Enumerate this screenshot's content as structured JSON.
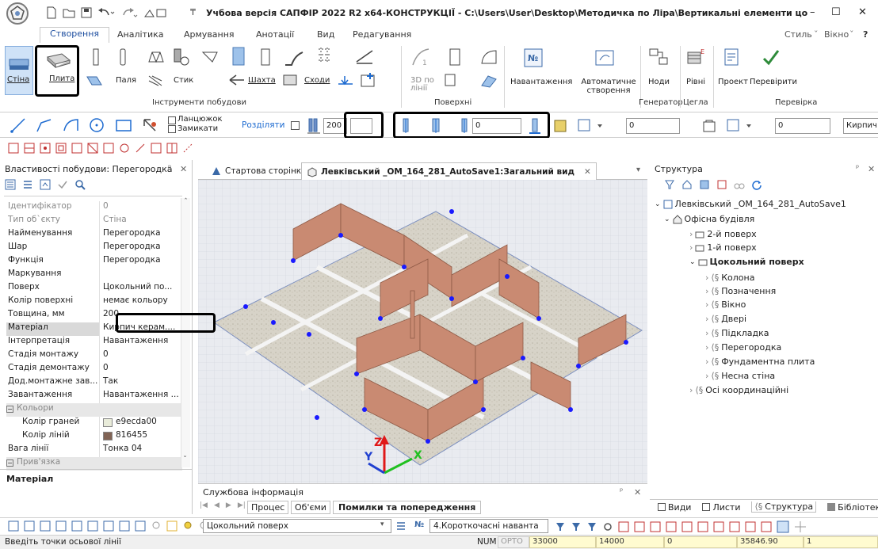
{
  "window": {
    "title": "Учбова версія САПФІР 2022 R2 x64-КОНСТРУКЦІЇ - C:\\Users\\User\\Desktop\\Методичка по Ліра\\Вертикальні елементи цоколя\\Левківськ...",
    "minimize": "–",
    "maximize": "☐",
    "close": "✕"
  },
  "menu": {
    "tabs": [
      "Створення",
      "Аналітика",
      "Армування",
      "Анотації",
      "Вид",
      "Редагування"
    ],
    "right": [
      "Стиль",
      "Вікно",
      "?"
    ]
  },
  "ribbon": {
    "buttons": {
      "wall": "Стіна",
      "slab": "Плита",
      "pile": "Паля",
      "column": "Стик",
      "shaft": "Шахта",
      "stairs": "Сходи",
      "surface3d": "3D по лінії",
      "loads": "Навантаження",
      "auto_create": "Автоматичне створення",
      "nodes": "Ноди",
      "levels": "Рівні",
      "project": "Проект",
      "verify": "Перевірити"
    },
    "groups": {
      "build_tools": "Інструменти побудови",
      "surfaces": "Поверхні",
      "generator": "Генератор",
      "bricks": "Цегла",
      "check": "Перевірка"
    }
  },
  "toolbar": {
    "chain_label": "Ланцюжок",
    "close_label": "Замикати",
    "split_label": "Розділяти",
    "thickness": "200",
    "height_value": "",
    "offset1": "0",
    "offset2": "0",
    "offset3": "0",
    "material_short": "Кирпич"
  },
  "left_panel": {
    "title": "Властивості побудови: Перегородка",
    "pin": "ᵖ",
    "close": "✕",
    "rows": [
      {
        "k": "Ідентифікатор",
        "v": "0",
        "muted": true
      },
      {
        "k": "Тип об`єкту",
        "v": "Стіна",
        "muted": true
      },
      {
        "k": "Найменування",
        "v": "Перегородка"
      },
      {
        "k": "Шар",
        "v": "Перегородка"
      },
      {
        "k": "Функція",
        "v": "Перегородка"
      },
      {
        "k": "Маркування",
        "v": ""
      },
      {
        "k": "Поверх",
        "v": "Цокольний по..."
      },
      {
        "k": "Колір поверхні",
        "v": "немає кольору"
      },
      {
        "k": "Товщина, мм",
        "v": "200"
      },
      {
        "k": "Матеріал",
        "v": "Кирпич керам....",
        "sel": true
      },
      {
        "k": "Інтерпретація",
        "v": "Навантаження"
      },
      {
        "k": "Стадія монтажу",
        "v": "0"
      },
      {
        "k": "Стадія демонтажу",
        "v": "0"
      },
      {
        "k": "Дод.монтажне зав...",
        "v": "Так"
      },
      {
        "k": "Завантаження",
        "v": "Навантаження ..."
      }
    ],
    "colors_group": "Кольори",
    "face_color_label": "Колір граней",
    "face_color_value": "e9ecda00",
    "face_color": "#e9ecda",
    "line_color_label": "Колір ліній",
    "line_color_value": "816455",
    "line_color": "#816455",
    "line_weight_label": "Вага лінії",
    "line_weight_value": "Тонка 04",
    "binding_group": "Прив'язка",
    "desc_title": "Матеріал"
  },
  "doc_tabs": {
    "start": "Стартова сторінка",
    "model": "Левківський _ОМ_164_281_AutoSave1:Загальний вид"
  },
  "bottom_panel": {
    "title": "Службова інформація",
    "tabs": [
      "Процес",
      "Об'єми",
      "Помилки та попередження"
    ]
  },
  "structure": {
    "title": "Структура",
    "root": "Левківський _ОМ_164_281_AutoSave1",
    "building": "Офісна будівля",
    "floors": [
      "2-й поверх",
      "1-й поверх"
    ],
    "active_floor": "Цокольний поверх",
    "groups": [
      "Колона",
      "Позначення",
      "Вікно",
      "Двері",
      "Підкладка",
      "Перегородка",
      "Фундаментна плита",
      "Несна стіна"
    ],
    "axes": "Осі координаційні"
  },
  "right_tabs": [
    "Види",
    "Листи",
    "Структура",
    "Бібліотеки"
  ],
  "bottom_toolbar": {
    "floor": "Цокольний поверх",
    "load": "4.Короткочасні наванта"
  },
  "status": {
    "prompt": "Введіть точки осьової лінії",
    "num": "NUM",
    "opto": "ОРТО",
    "v1": "33000",
    "v2": "14000",
    "v3": "0",
    "v4": "35846.90",
    "v5": "1"
  }
}
